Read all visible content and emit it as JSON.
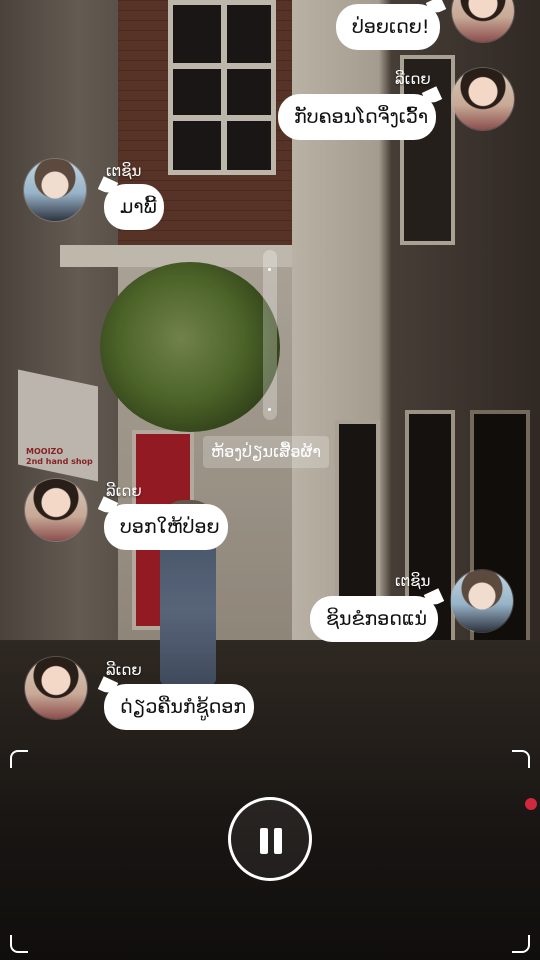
{
  "messages": [
    {
      "name": "",
      "text": "ປ່ອຍເດຍ!",
      "side": "right",
      "avatar": "female"
    },
    {
      "name": "ລີເດຍ",
      "text": "ກັບຄອນໂດຈຶ່ງເວົ້າ",
      "side": "right",
      "avatar": "female"
    },
    {
      "name": "ເຕຊິນ",
      "text": "ມາພີ້",
      "side": "left",
      "avatar": "male"
    },
    {
      "name": "ລີເດຍ",
      "text": "ບອກໃຫ້ປ່ອຍ",
      "side": "left",
      "avatar": "female"
    },
    {
      "name": "ເຕຊິນ",
      "text": "ຊິນຂໍກອດແນ່",
      "side": "right",
      "avatar": "male"
    },
    {
      "name": "ລີເດຍ",
      "text": "ດ່ຽວຄືນກໍຊູ້ດອກ",
      "side": "left",
      "avatar": "female"
    }
  ],
  "location_tag": "ຫ້ອງປ່ຽນເສື້ອຜ້າ",
  "background": {
    "sign_line1": "MOOIZO",
    "sign_line2": "2nd hand shop"
  },
  "controls": {
    "pause_icon": "pause-icon",
    "record_indicator_color": "#d0283c"
  }
}
